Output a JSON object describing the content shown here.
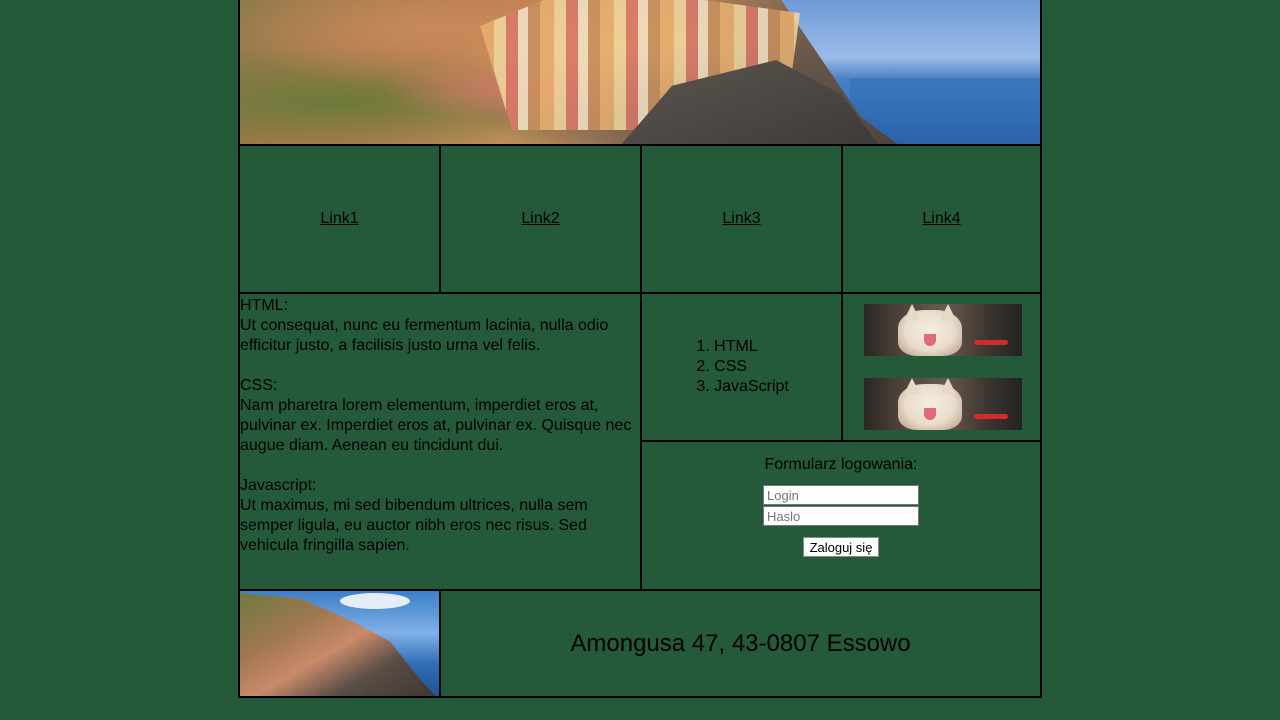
{
  "nav": {
    "links": [
      "Link1",
      "Link2",
      "Link3",
      "Link4"
    ]
  },
  "content": {
    "html_heading": "HTML:",
    "html_text": "Ut consequat, nunc eu fermentum lacinia, nulla odio efficitur justo, a facilisis justo urna vel felis.",
    "css_heading": "CSS:",
    "css_text": "Nam pharetra lorem elementum, imperdiet eros at, pulvinar ex. Imperdiet eros at, pulvinar ex. Quisque nec augue diam. Aenean eu tincidunt dui.",
    "js_heading": "Javascript:",
    "js_text": "Ut maximus, mi sed bibendum ultrices, nulla sem semper ligula, eu auctor nibh eros nec risus. Sed vehicula fringilla sapien."
  },
  "list": {
    "items": [
      "HTML",
      "CSS",
      "JavaScript"
    ]
  },
  "login": {
    "title": "Formularz logowania:",
    "login_placeholder": "Login",
    "password_placeholder": "Haslo",
    "submit_label": "Zaloguj się"
  },
  "footer": {
    "address": "Amongusa 47, 43-0807 Essowo"
  },
  "colors": {
    "background": "#245a3a",
    "border": "#000000"
  }
}
